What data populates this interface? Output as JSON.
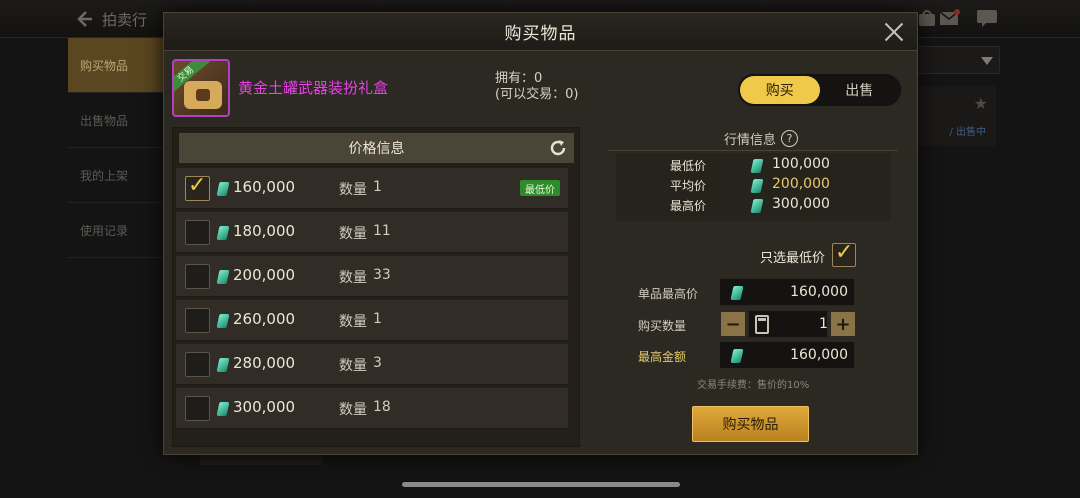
{
  "background": {
    "back_label": "拍卖行",
    "sidebar": [
      "购买物品",
      "出售物品",
      "我的上架",
      "使用记录"
    ],
    "card_text": "/ 出售中"
  },
  "modal": {
    "title": "购买物品",
    "item": {
      "name": "黄金土罐武器装扮礼盒",
      "ribbon": "交易",
      "owned": "拥有：0",
      "tradable": "(可以交易：0)"
    },
    "toggle": {
      "buy": "购买",
      "sell": "出售",
      "active": "buy"
    },
    "price_list": {
      "header": "价格信息",
      "qty_label": "数量",
      "lowest_badge": "最低价",
      "rows": [
        {
          "price": "160,000",
          "qty": "1",
          "checked": true,
          "lowest": true
        },
        {
          "price": "180,000",
          "qty": "11",
          "checked": false,
          "lowest": false
        },
        {
          "price": "200,000",
          "qty": "33",
          "checked": false,
          "lowest": false
        },
        {
          "price": "260,000",
          "qty": "1",
          "checked": false,
          "lowest": false
        },
        {
          "price": "280,000",
          "qty": "3",
          "checked": false,
          "lowest": false
        },
        {
          "price": "300,000",
          "qty": "18",
          "checked": false,
          "lowest": false
        }
      ]
    },
    "market": {
      "title": "行情信息",
      "help": "?",
      "lowest_label": "最低价",
      "lowest_value": "100,000",
      "avg_label": "平均价",
      "avg_value": "200,000",
      "highest_label": "最高价",
      "highest_value": "300,000"
    },
    "controls": {
      "only_lowest": "只选最低价",
      "only_lowest_checked": true,
      "unit_max_label": "单品最高价",
      "unit_max_value": "160,000",
      "qty_label": "购买数量",
      "qty_value": "1",
      "total_label": "最高金额",
      "total_value": "160,000",
      "minus": "−",
      "plus": "+",
      "fee_note": "交易手续费：售价的10%",
      "buy_button": "购买物品"
    }
  },
  "colors": {
    "accent_gold": "#f0c94a",
    "item_name_magenta": "#e641e6",
    "lowest_badge_green": "#2e8b2a"
  }
}
